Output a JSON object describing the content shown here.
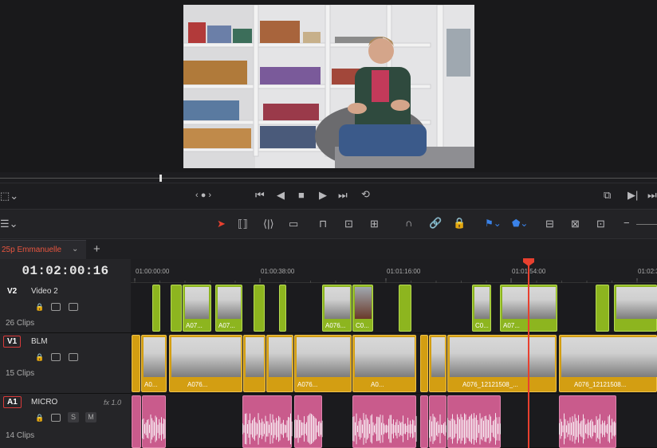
{
  "timeline_name": "25p Emmanuelle",
  "timecode": "01:02:00:16",
  "ruler": [
    "01:00:00:00",
    "01:00:38:00",
    "01:01:16:00",
    "01:01:54:00",
    "01:02:3"
  ],
  "tracks": [
    {
      "id": "V2",
      "name": "Video 2",
      "clips": "26 Clips"
    },
    {
      "id": "V1",
      "name": "BLM",
      "clips": "15 Clips"
    },
    {
      "id": "A1",
      "name": "MICRO",
      "clips": "14 Clips",
      "fx": "fx 1.0"
    }
  ],
  "v2_labels": [
    "A07...",
    "A07...",
    "A076...",
    "C0...",
    "C0...",
    "A07..."
  ],
  "v1_labels": [
    "A0...",
    "A076...",
    "A076...",
    "A0...",
    "A076_12121508_...",
    "A076_12121508..."
  ],
  "solo": "S",
  "mute": "M",
  "colors": {
    "video": "#8db51f",
    "video_audio": "#d39e12",
    "audio": "#c95b8c",
    "playhead": "#e8402f",
    "accent_red": "#d83a3a"
  }
}
